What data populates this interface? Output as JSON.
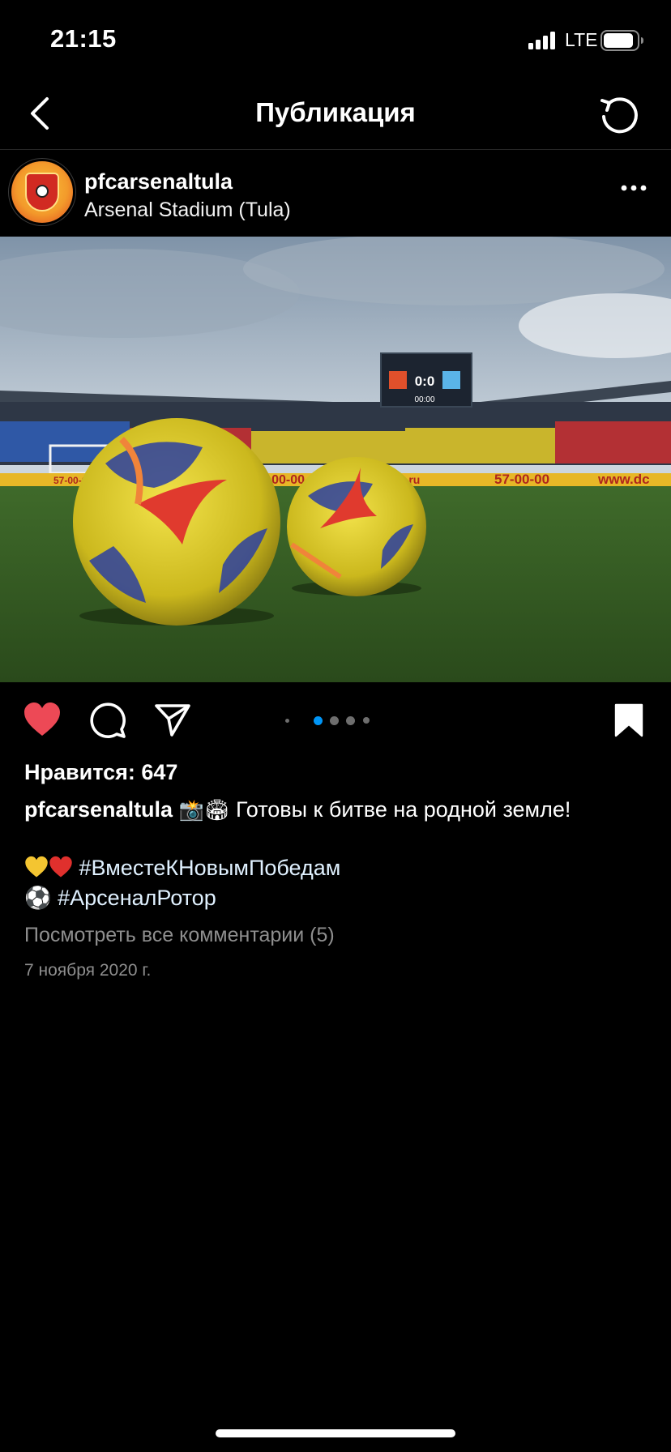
{
  "status_bar": {
    "time": "21:15",
    "network": "LTE",
    "icons": [
      "signal-icon",
      "battery-icon"
    ]
  },
  "nav": {
    "title": "Публикация",
    "icons": [
      "back-icon",
      "refresh-icon"
    ]
  },
  "post": {
    "username": "pfcarsenaltula",
    "location": "Arsenal Stadium (Tula)",
    "photo": {
      "scoreboard_score": "0:0",
      "scoreboard_time": "00:00",
      "ad_board_texts": [
        "57-00-00",
        "57-00-00",
        "mru.ru",
        "57-00-00",
        "www.dc"
      ]
    },
    "carousel": {
      "count": 5,
      "active_index": 1
    },
    "liked": true,
    "likes_text": "Нравится: 647",
    "caption": {
      "username": "pfcarsenaltula",
      "emojis": "📸🏟",
      "text": "Готовы к битве на родной земле!",
      "hashtag_1": "#ВместеКНовымПобедам",
      "hashtag_2": "#АрсеналРотор",
      "ball_emoji": "⚽"
    },
    "view_comments": "Посмотреть все комментарии (5)",
    "date": "7 ноября 2020 г."
  },
  "colors": {
    "background": "#000000",
    "like_red": "#ed4956",
    "active_dot": "#0095f6",
    "muted_text": "#8e8e8e"
  }
}
